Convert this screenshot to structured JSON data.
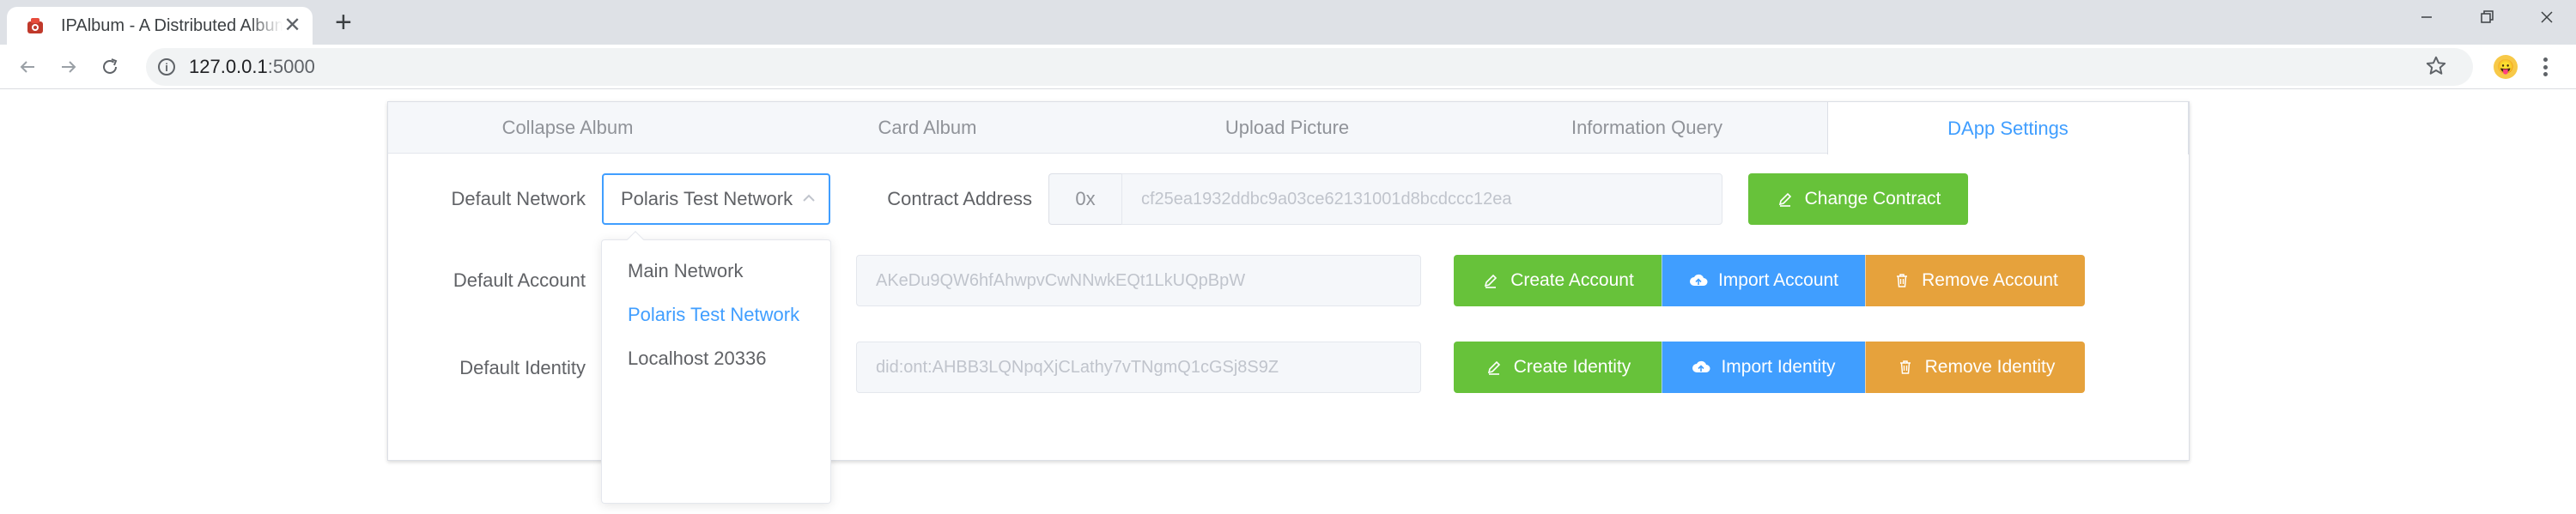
{
  "browser": {
    "tab_title": "IPAlbum - A Distributed Album",
    "url_host": "127.0.0.1",
    "url_port": ":5000",
    "new_tab_label": "+",
    "close_label": "✕"
  },
  "app": {
    "tabs": [
      {
        "label": "Collapse Album",
        "active": false
      },
      {
        "label": "Card Album",
        "active": false
      },
      {
        "label": "Upload Picture",
        "active": false
      },
      {
        "label": "Information Query",
        "active": false
      },
      {
        "label": "DApp Settings",
        "active": true
      }
    ],
    "network": {
      "label": "Default Network",
      "selected": "Polaris Test Network",
      "options": [
        {
          "label": "Main Network",
          "selected": false
        },
        {
          "label": "Polaris Test Network",
          "selected": true
        },
        {
          "label": "Localhost 20336",
          "selected": false
        }
      ]
    },
    "contract": {
      "label": "Contract Address",
      "prefix": "0x",
      "value": "cf25ea1932ddbc9a03ce62131001d8bcdccc12ea",
      "button": "Change Contract"
    },
    "account": {
      "label": "Default Account",
      "value": "AKeDu9QW6hfAhwpvCwNNwkEQt1LkUQpBpW",
      "create": "Create Account",
      "import": "Import Account",
      "remove": "Remove Account"
    },
    "identity": {
      "label": "Default Identity",
      "value": "did:ont:AHBB3LQNpqXjCLathy7vTNgmQ1cGSj8S9Z",
      "create": "Create Identity",
      "import": "Import Identity",
      "remove": "Remove Identity"
    }
  },
  "colors": {
    "primary": "#409eff",
    "success": "#67c23a",
    "warning": "#e6a23c"
  }
}
